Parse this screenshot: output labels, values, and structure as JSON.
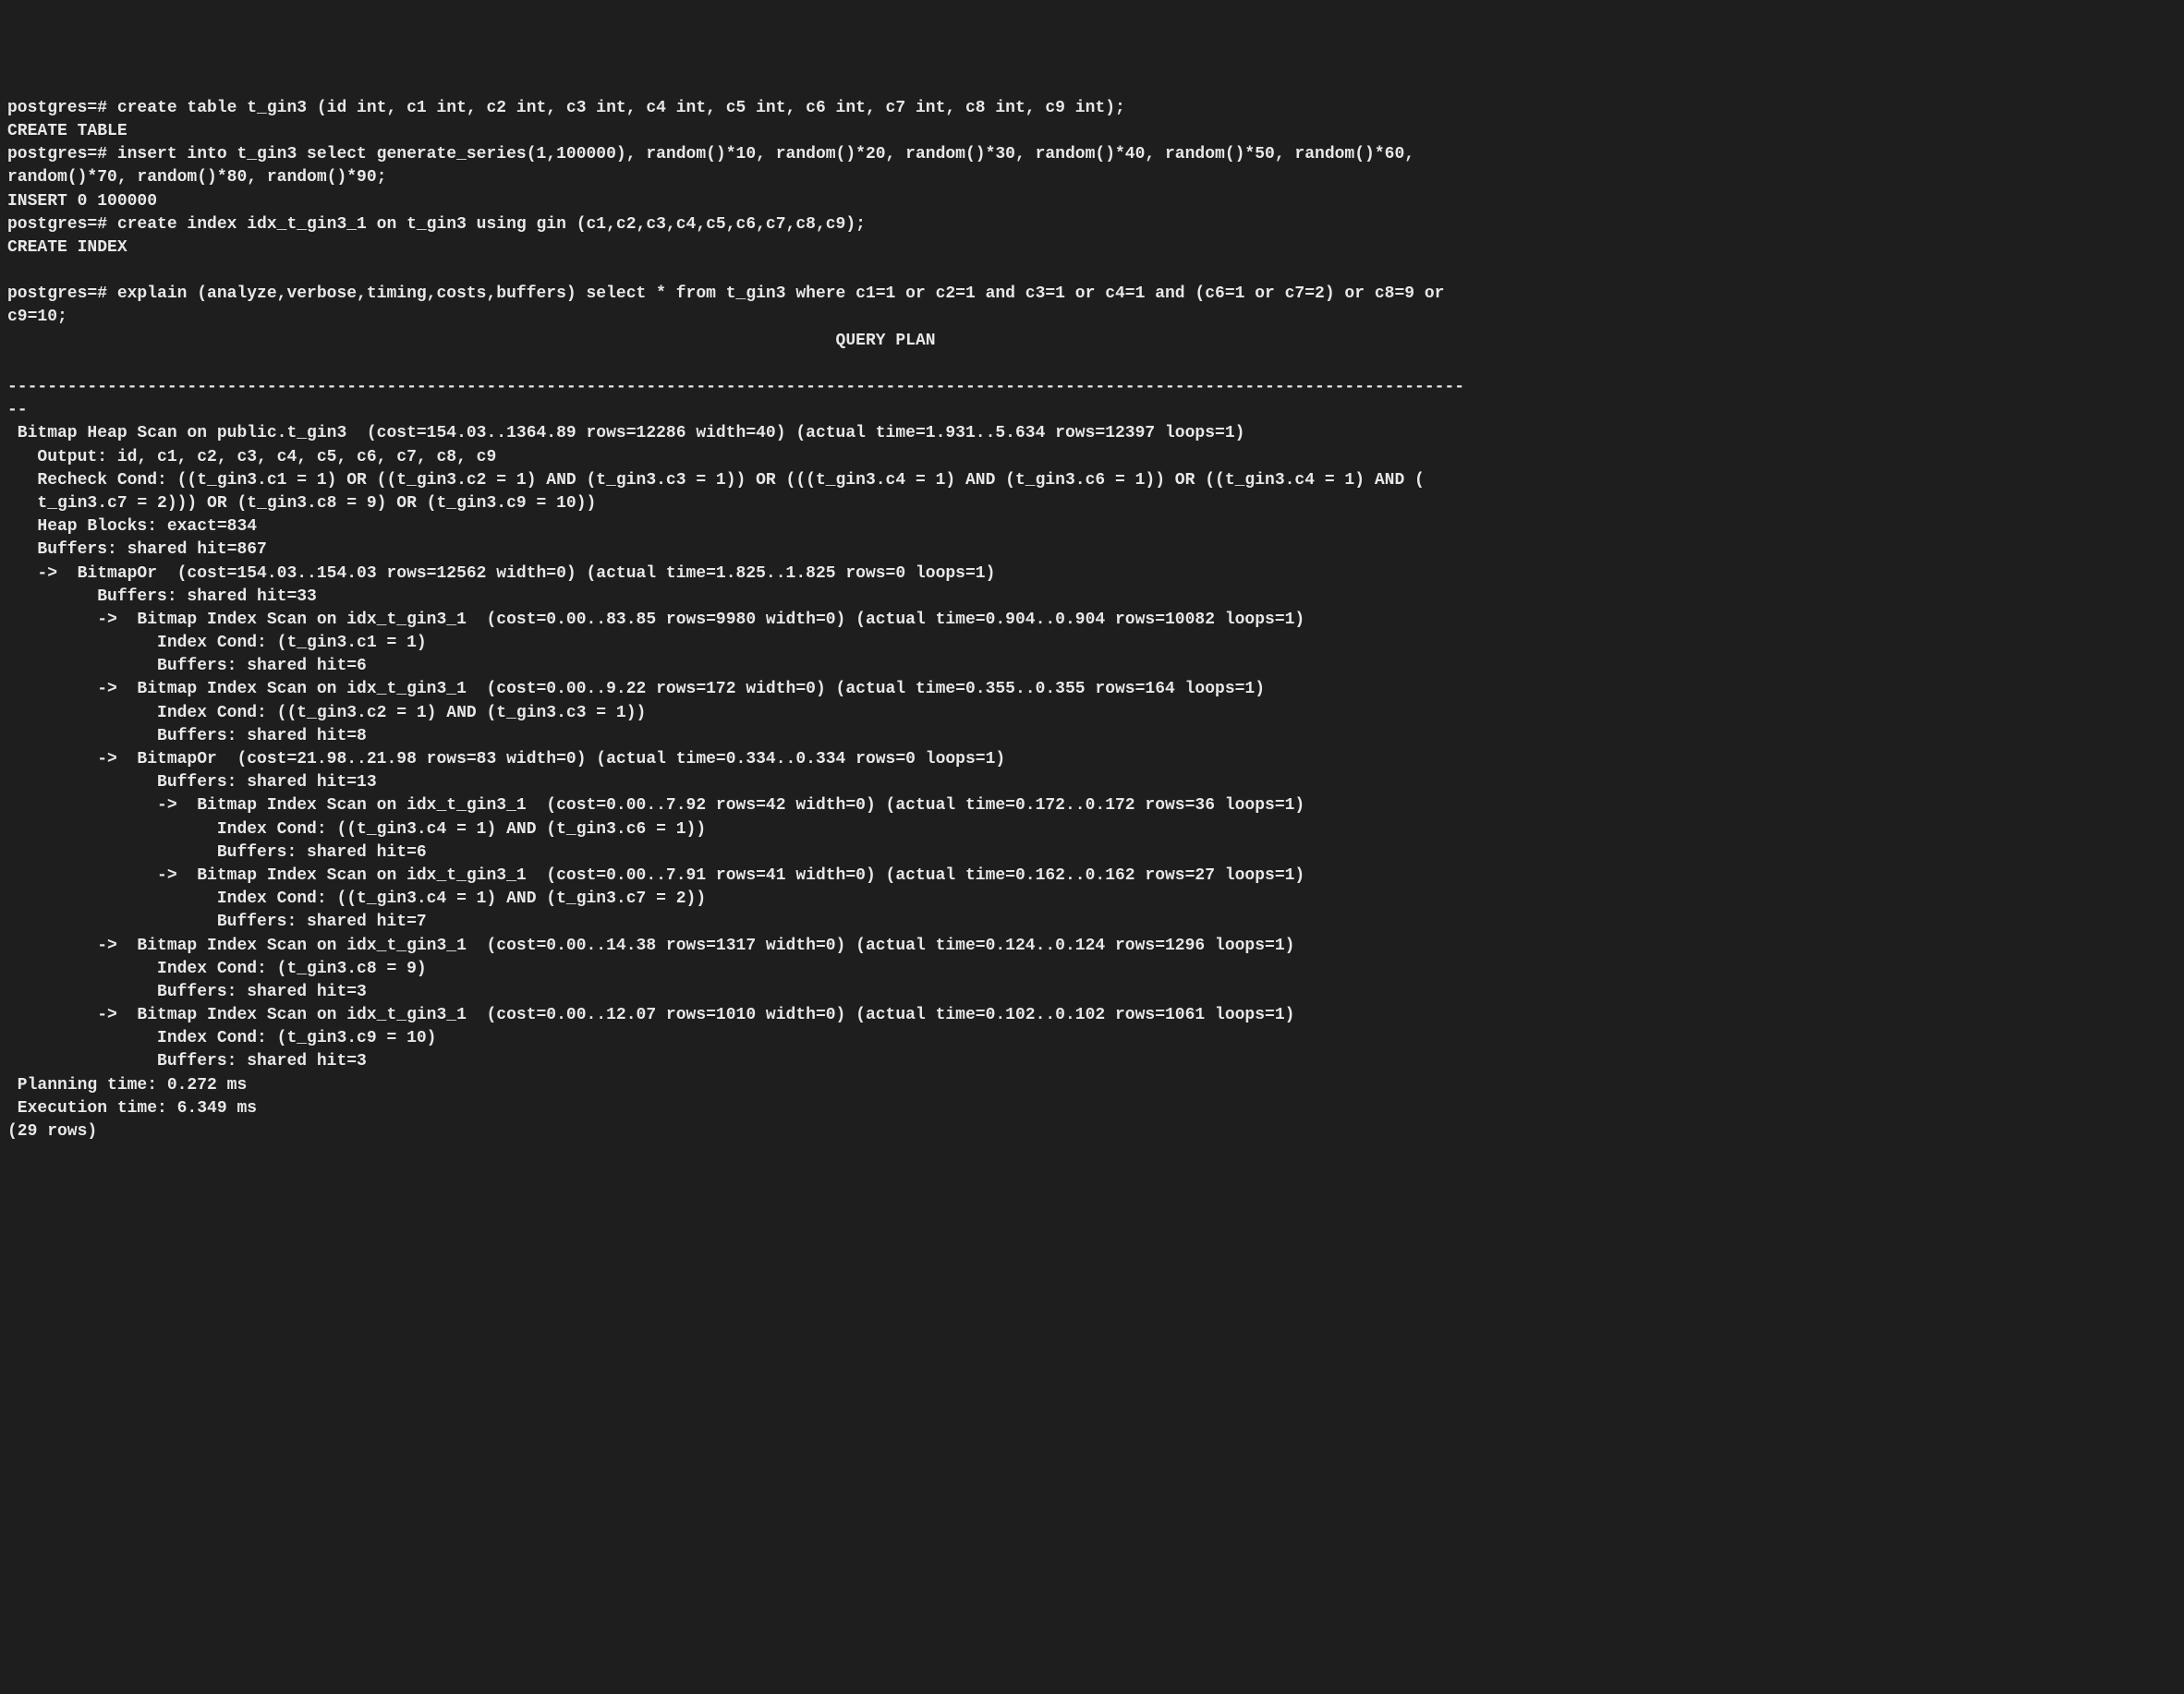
{
  "terminal": {
    "lines": [
      "postgres=# create table t_gin3 (id int, c1 int, c2 int, c3 int, c4 int, c5 int, c6 int, c7 int, c8 int, c9 int);",
      "CREATE TABLE",
      "postgres=# insert into t_gin3 select generate_series(1,100000), random()*10, random()*20, random()*30, random()*40, random()*50, random()*60,",
      "random()*70, random()*80, random()*90;",
      "INSERT 0 100000",
      "postgres=# create index idx_t_gin3_1 on t_gin3 using gin (c1,c2,c3,c4,c5,c6,c7,c8,c9);",
      "CREATE INDEX",
      "",
      "postgres=# explain (analyze,verbose,timing,costs,buffers) select * from t_gin3 where c1=1 or c2=1 and c3=1 or c4=1 and (c6=1 or c7=2) or c8=9 or",
      "c9=10;",
      "                                                                                   QUERY PLAN",
      "",
      "--------------------------------------------------------------------------------------------------------------------------------------------------",
      "--",
      " Bitmap Heap Scan on public.t_gin3  (cost=154.03..1364.89 rows=12286 width=40) (actual time=1.931..5.634 rows=12397 loops=1)",
      "   Output: id, c1, c2, c3, c4, c5, c6, c7, c8, c9",
      "   Recheck Cond: ((t_gin3.c1 = 1) OR ((t_gin3.c2 = 1) AND (t_gin3.c3 = 1)) OR (((t_gin3.c4 = 1) AND (t_gin3.c6 = 1)) OR ((t_gin3.c4 = 1) AND (",
      "   t_gin3.c7 = 2))) OR (t_gin3.c8 = 9) OR (t_gin3.c9 = 10))",
      "   Heap Blocks: exact=834",
      "   Buffers: shared hit=867",
      "   ->  BitmapOr  (cost=154.03..154.03 rows=12562 width=0) (actual time=1.825..1.825 rows=0 loops=1)",
      "         Buffers: shared hit=33",
      "         ->  Bitmap Index Scan on idx_t_gin3_1  (cost=0.00..83.85 rows=9980 width=0) (actual time=0.904..0.904 rows=10082 loops=1)",
      "               Index Cond: (t_gin3.c1 = 1)",
      "               Buffers: shared hit=6",
      "         ->  Bitmap Index Scan on idx_t_gin3_1  (cost=0.00..9.22 rows=172 width=0) (actual time=0.355..0.355 rows=164 loops=1)",
      "               Index Cond: ((t_gin3.c2 = 1) AND (t_gin3.c3 = 1))",
      "               Buffers: shared hit=8",
      "         ->  BitmapOr  (cost=21.98..21.98 rows=83 width=0) (actual time=0.334..0.334 rows=0 loops=1)",
      "               Buffers: shared hit=13",
      "               ->  Bitmap Index Scan on idx_t_gin3_1  (cost=0.00..7.92 rows=42 width=0) (actual time=0.172..0.172 rows=36 loops=1)",
      "                     Index Cond: ((t_gin3.c4 = 1) AND (t_gin3.c6 = 1))",
      "                     Buffers: shared hit=6",
      "               ->  Bitmap Index Scan on idx_t_gin3_1  (cost=0.00..7.91 rows=41 width=0) (actual time=0.162..0.162 rows=27 loops=1)",
      "                     Index Cond: ((t_gin3.c4 = 1) AND (t_gin3.c7 = 2))",
      "                     Buffers: shared hit=7",
      "         ->  Bitmap Index Scan on idx_t_gin3_1  (cost=0.00..14.38 rows=1317 width=0) (actual time=0.124..0.124 rows=1296 loops=1)",
      "               Index Cond: (t_gin3.c8 = 9)",
      "               Buffers: shared hit=3",
      "         ->  Bitmap Index Scan on idx_t_gin3_1  (cost=0.00..12.07 rows=1010 width=0) (actual time=0.102..0.102 rows=1061 loops=1)",
      "               Index Cond: (t_gin3.c9 = 10)",
      "               Buffers: shared hit=3",
      " Planning time: 0.272 ms",
      " Execution time: 6.349 ms",
      "(29 rows)"
    ]
  }
}
